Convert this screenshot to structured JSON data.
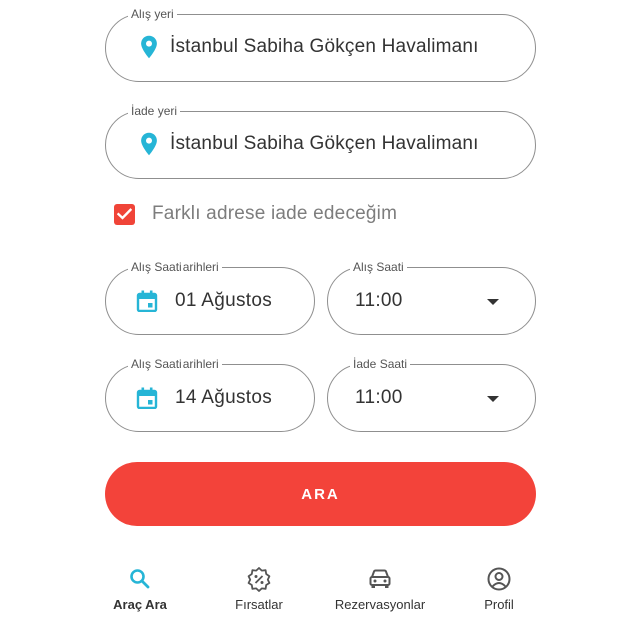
{
  "pickup": {
    "legend": "Alış yeri",
    "value": "İstanbul Sabiha Gökçen Havalimanı"
  },
  "dropoff": {
    "legend": "İade yeri",
    "value": "İstanbul Sabiha Gökçen Havalimanı"
  },
  "different_address": {
    "label": "Farklı adrese iade edeceğim",
    "checked": true
  },
  "pickup_date": {
    "legend": "Alış Saati",
    "legend_extra": "arihleri",
    "value": "01 Ağustos"
  },
  "pickup_time": {
    "legend": "Alış Saati",
    "value": "11:00"
  },
  "return_date": {
    "legend": "Alış Saati",
    "legend_extra": "arihleri",
    "value": "14 Ağustos"
  },
  "return_time": {
    "legend": "İade Saati",
    "value": "11:00"
  },
  "search_button": {
    "label": "ARA"
  },
  "bottom_nav": [
    {
      "label": "Araç Ara",
      "icon": "search-icon",
      "active": true
    },
    {
      "label": "Fırsatlar",
      "icon": "discount-badge-icon",
      "active": false
    },
    {
      "label": "Rezervasyonlar",
      "icon": "car-icon",
      "active": false
    },
    {
      "label": "Profil",
      "icon": "profile-icon",
      "active": false
    }
  ],
  "colors": {
    "accent": "#f3433a",
    "icon": "#26b5d6",
    "checkbox": "#f04438"
  }
}
